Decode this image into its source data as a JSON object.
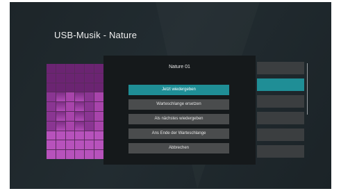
{
  "header": {
    "title": "USB-Musik - Nature"
  },
  "dialog": {
    "title": "Nature 01",
    "options": [
      {
        "label": "Jetzt wiedergeben",
        "selected": true
      },
      {
        "label": "Warteschlange ersetzen",
        "selected": false
      },
      {
        "label": "Als nächstes wiedergeben",
        "selected": false
      },
      {
        "label": "Ans Ende der Warteschlange",
        "selected": false
      },
      {
        "label": "Abbrechen",
        "selected": false
      }
    ]
  },
  "colors": {
    "accent": "#1f8e96",
    "background": "#1f272b",
    "dialog": "#15191b",
    "button": "#4a4c4d",
    "album_art": "#a844ab"
  }
}
